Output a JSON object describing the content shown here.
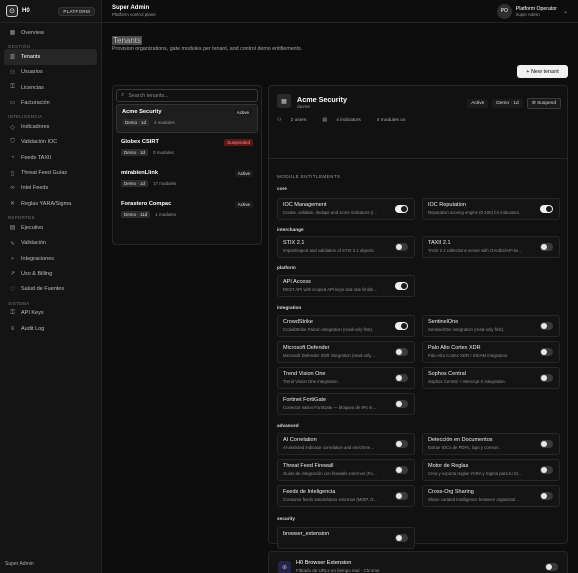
{
  "app": {
    "name": "H0",
    "tag": "PLATFORM"
  },
  "sidebar": {
    "sections": [
      {
        "label": "",
        "items": [
          {
            "label": "Overview",
            "icon": "grid-icon"
          }
        ]
      },
      {
        "label": "GESTIÓN",
        "items": [
          {
            "label": "Tenants",
            "icon": "building-icon",
            "active": true
          },
          {
            "label": "Usuarios",
            "icon": "users-icon"
          },
          {
            "label": "Licencias",
            "icon": "key-icon"
          },
          {
            "label": "Facturación",
            "icon": "card-icon"
          }
        ]
      },
      {
        "label": "INTELIGENCIA",
        "items": [
          {
            "label": "Indicadores",
            "icon": "tag-icon"
          },
          {
            "label": "Validación IOC",
            "icon": "shield-check-icon"
          },
          {
            "label": "Feeds TAXII",
            "icon": "rss-icon"
          },
          {
            "label": "Threat Feed Guías",
            "icon": "book-icon"
          },
          {
            "label": "Intel Feeds",
            "icon": "link-icon"
          },
          {
            "label": "Reglas YARA/Sigma",
            "icon": "cross-icon"
          }
        ]
      },
      {
        "label": "REPORTES",
        "items": [
          {
            "label": "Ejecutivo",
            "icon": "doc-icon"
          },
          {
            "label": "Validación",
            "icon": "pulse-icon"
          },
          {
            "label": "Integraciones",
            "icon": "plug-icon"
          },
          {
            "label": "Uso & Billing",
            "icon": "trend-icon"
          },
          {
            "label": "Salud de Fuentes",
            "icon": "heart-icon"
          }
        ]
      },
      {
        "label": "SISTEMA",
        "items": [
          {
            "label": "API Keys",
            "icon": "key-icon"
          },
          {
            "label": "Audit Log",
            "icon": "list-icon"
          }
        ]
      }
    ],
    "footer": "Super Admin"
  },
  "topbar": {
    "title": "Super Admin",
    "subtitle": "Platform control plane"
  },
  "user": {
    "initials": "PO",
    "name": "Platform Operator",
    "role": "Super Admin"
  },
  "page": {
    "title": "Tenants",
    "subtitle": "Provision organizations, gate modules per tenant, and control demo entitlements.",
    "new_button": "+ New tenant"
  },
  "search": {
    "placeholder": "Search tenants..."
  },
  "tenants": [
    {
      "name": "Acme Security",
      "plan": "Demo · 1d",
      "modules": "4 modules",
      "status": "Active",
      "suspended": false,
      "selected": true
    },
    {
      "name": "Globex CSIRT",
      "plan": "Demo · 1d",
      "modules": "0 modules",
      "status": "Suspended",
      "suspended": true,
      "selected": false
    },
    {
      "name": "mirabienLlink",
      "plan": "Demo · 1d",
      "modules": "17 modules",
      "status": "Active",
      "suspended": false,
      "selected": false
    },
    {
      "name": "Forastero Compac",
      "plan": "Demo · 11d",
      "modules": "1 modules",
      "status": "Active",
      "suspended": false,
      "selected": false
    }
  ],
  "detail": {
    "name": "Acme Security",
    "slug": "/acme",
    "status": "Active",
    "plan": "Demo · 1d",
    "suspend_label": "Suspend",
    "stats": {
      "users": "2 users",
      "indicators": "4 indicators",
      "modules": "4 modules on"
    },
    "modules_title": "MODULE ENTITLEMENTS",
    "categories": [
      "core",
      "interchange",
      "platform",
      "integration",
      "advanced",
      "security"
    ],
    "modules": [
      {
        "cat": 0,
        "name": "IOC Management",
        "desc": "Create, validate, dedupe and score indicators (I…",
        "on": true
      },
      {
        "cat": 0,
        "name": "IOC Reputation",
        "desc": "Reputation scoring engine (0-100) for indicators.",
        "on": true
      },
      {
        "cat": 1,
        "name": "STIX 2.1",
        "desc": "Import/export and validation of STIX 2.1 objects.",
        "on": false
      },
      {
        "cat": 1,
        "name": "TAXII 2.1",
        "desc": "TAXII 2.1 collections server with OAuth2/API ke…",
        "on": false
      },
      {
        "cat": 2,
        "name": "API Access",
        "desc": "REST API with scoped API keys and rate limitin…",
        "on": true
      },
      {
        "cat": 3,
        "name": "CrowdStrike",
        "desc": "CrowdStrike Falcon integration (read-only first).",
        "on": true
      },
      {
        "cat": 3,
        "name": "SentinelOne",
        "desc": "SentinelOne integration (read-only first).",
        "on": false
      },
      {
        "cat": 3,
        "name": "Microsoft Defender",
        "desc": "Microsoft Defender XDR integration (read-only …",
        "on": false
      },
      {
        "cat": 3,
        "name": "Palo Alto Cortex XDR",
        "desc": "Palo Alto Cortex XDR / XSIAM integration.",
        "on": false
      },
      {
        "cat": 3,
        "name": "Trend Vision One",
        "desc": "Trend Vision One integration.",
        "on": false
      },
      {
        "cat": 3,
        "name": "Sophos Central",
        "desc": "Sophos Central + Intercept X integration.",
        "on": false
      },
      {
        "cat": 3,
        "name": "Fortinet FortiGate",
        "desc": "Conector nativo FortiGate — bloqueo de IPs m…",
        "on": false
      },
      {
        "cat": 4,
        "name": "AI Correlation",
        "desc": "AI-assisted indicator correlation and enrichme…",
        "on": false
      },
      {
        "cat": 4,
        "name": "Detección en Documentos",
        "desc": "Extrae IOCs de PDFs, logs y correos.",
        "on": false
      },
      {
        "cat": 4,
        "name": "Threat Feed Firewall",
        "desc": "Guías de integración con firewalls externos (Fo…",
        "on": false
      },
      {
        "cat": 4,
        "name": "Motor de Reglas",
        "desc": "Crea y exporta reglas YARA y Sigma para tu SI…",
        "on": false
      },
      {
        "cat": 4,
        "name": "Feeds de Inteligencia",
        "desc": "Consume feeds automáticos externos (MISP, O…",
        "on": false
      },
      {
        "cat": 4,
        "name": "Cross-Org Sharing",
        "desc": "Share curated intelligence between organizati…",
        "on": false
      },
      {
        "cat": 5,
        "name": "browser_extension",
        "desc": "",
        "on": false
      }
    ]
  },
  "extension": {
    "name": "H0 Browser Extension",
    "desc": "Filtrado de URLs en tiempo real · Chrome",
    "on": false
  }
}
